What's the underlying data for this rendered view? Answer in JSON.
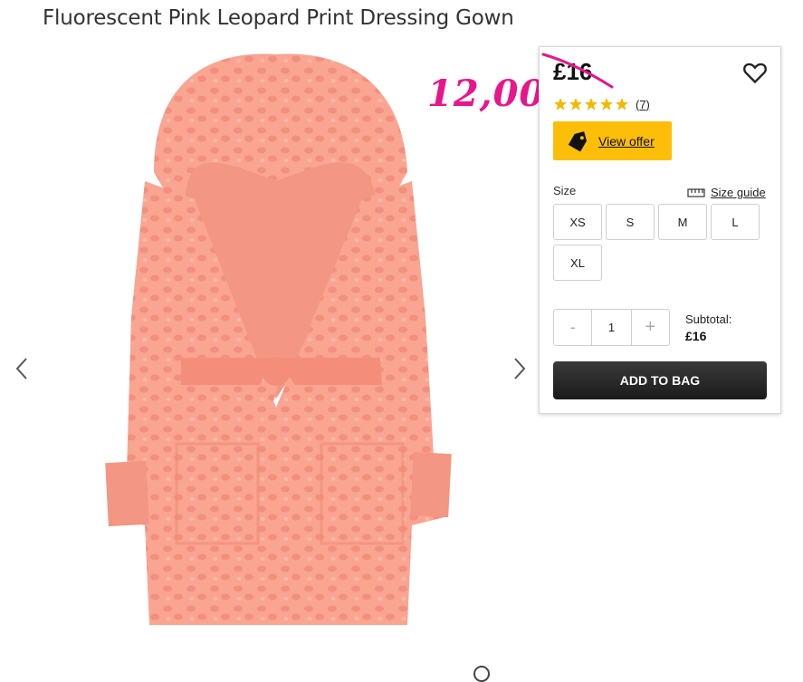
{
  "product": {
    "title": "Fluorescent Pink Leopard Print Dressing Gown"
  },
  "annotation": {
    "handwritten_price": "12,00"
  },
  "panel": {
    "price": "£16",
    "rating_stars": 5,
    "reviews": "(7)",
    "offer_label": "View offer",
    "size_label": "Size",
    "size_guide": "Size guide",
    "sizes": [
      "XS",
      "S",
      "M",
      "L",
      "XL"
    ],
    "quantity": {
      "minus": "-",
      "value": "1",
      "plus": "+"
    },
    "subtotal_label": "Subtotal:",
    "subtotal_value": "£16",
    "add_to_bag": "ADD TO BAG"
  },
  "colors": {
    "accent_offer": "#fdbe0a",
    "annotation_pink": "#e8168c",
    "button_dark": "#222222",
    "star_yellow": "#f5b800",
    "gown_pink": "#f7a08c"
  }
}
